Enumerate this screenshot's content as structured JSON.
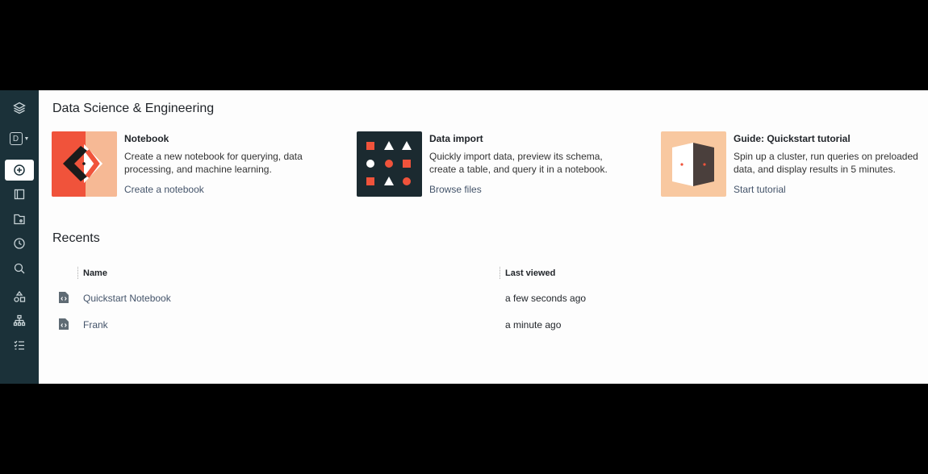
{
  "sidebar": {
    "items": [
      {
        "icon": "layers-icon"
      },
      {
        "icon": "workspace-badge-icon",
        "label": "D"
      },
      {
        "icon": "plus-circle-icon",
        "active": true
      },
      {
        "icon": "book-icon"
      },
      {
        "icon": "folder-icon"
      },
      {
        "icon": "clock-icon"
      },
      {
        "icon": "search-icon"
      },
      {
        "icon": "shapes-icon"
      },
      {
        "icon": "hierarchy-icon"
      },
      {
        "icon": "checklist-icon"
      }
    ]
  },
  "main": {
    "section_title": "Data Science & Engineering",
    "cards": [
      {
        "title": "Notebook",
        "description": "Create a new notebook for querying, data processing, and machine learning.",
        "link": "Create a notebook"
      },
      {
        "title": "Data import",
        "description": "Quickly import data, preview its schema, create a table, and query it in a notebook.",
        "link": "Browse files"
      },
      {
        "title": "Guide: Quickstart tutorial",
        "description": "Spin up a cluster, run queries on preloaded data, and display results in 5 minutes.",
        "link": "Start tutorial"
      }
    ],
    "recents": {
      "title": "Recents",
      "columns": {
        "name": "Name",
        "last_viewed": "Last viewed"
      },
      "rows": [
        {
          "icon": "notebook-file-icon",
          "name": "Quickstart Notebook",
          "last_viewed": "a few seconds ago"
        },
        {
          "icon": "notebook-file-icon",
          "name": "Frank",
          "last_viewed": "a minute ago"
        }
      ]
    }
  },
  "colors": {
    "sidebar_bg": "#1b3139",
    "accent": "#f0533b",
    "peach": "#f8c8a0"
  }
}
